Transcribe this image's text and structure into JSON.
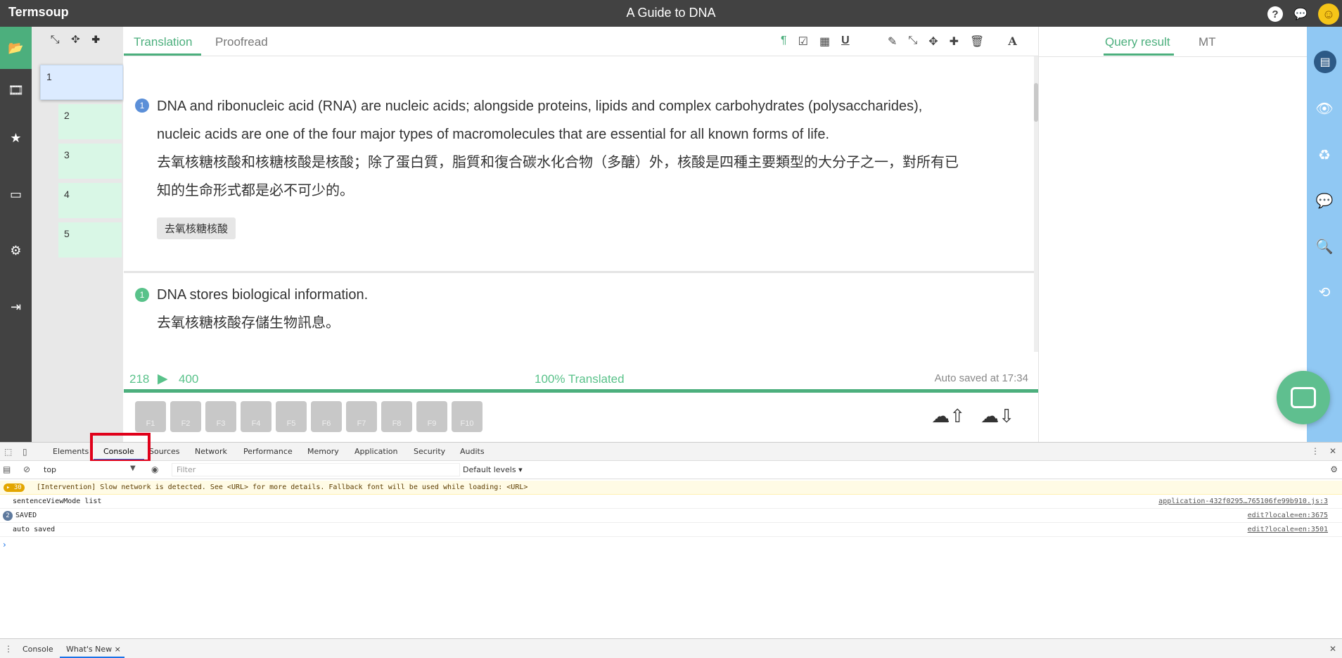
{
  "app": {
    "brand": "Termsoup",
    "title": "A Guide to DNA",
    "help_icon": "?",
    "chat_icon": "💬",
    "user_avatar": "☺"
  },
  "left_rail": {
    "icons": [
      "folder-icon",
      "film-icon",
      "star-icon",
      "store-icon",
      "gear-icon",
      "sign-out-icon"
    ],
    "glyphs": [
      "📂",
      "🎞",
      "★",
      "▭",
      "⚙",
      "⇥"
    ]
  },
  "segments": {
    "tools": "⤡ ✥ ✚",
    "items": [
      "1",
      "2",
      "3",
      "4",
      "5"
    ]
  },
  "editor": {
    "tabs": [
      "Translation",
      "Proofread"
    ],
    "toolbar_glyphs": [
      "¶",
      "☑",
      "▦",
      "U",
      "✎",
      "⤡",
      "✥",
      "✚",
      "🗑",
      "A"
    ],
    "blocks": [
      {
        "badge": "1",
        "source": "DNA and ribonucleic acid (RNA) are nucleic acids; alongside proteins, lipids and complex carbohydrates (polysaccharides), nucleic acids are one of the four major types of macromolecules that are essential for all known forms of life.",
        "target": "去氧核糖核酸和核糖核酸是核酸；除了蛋白質，脂質和復合碳水化合物（多醣）外，核酸是四種主要類型的大分子之一，對所有已知的生命形式都是必不可少的。",
        "term": "去氧核糖核酸"
      },
      {
        "badge": "1",
        "source": "DNA stores biological information.",
        "target": "去氧核糖核酸存儲生物訊息。"
      }
    ],
    "status": {
      "done": "218",
      "play_glyph": "▶",
      "total": "400",
      "translated": "100% Translated",
      "saved": "Auto saved at 17:34"
    },
    "fkeys": [
      "F1",
      "F2",
      "F3",
      "F4",
      "F5",
      "F6",
      "F7",
      "F8",
      "F9",
      "F10"
    ],
    "upload_glyph": "☁⇧",
    "download_glyph": "☁⇩"
  },
  "query_panel": {
    "tabs": [
      "Query result",
      "MT"
    ]
  },
  "right_rail": {
    "top_glyph": "▤",
    "glyphs": [
      "👁",
      "♻",
      "💬",
      "🔍",
      "⟲"
    ]
  },
  "devtools": {
    "tabs": [
      "Elements",
      "Console",
      "Sources",
      "Network",
      "Performance",
      "Memory",
      "Application",
      "Security",
      "Audits"
    ],
    "context": "top",
    "filter_placeholder": "Filter",
    "levels": "Default levels ▾",
    "logs": [
      {
        "badge": "▸ 30",
        "text": "[Intervention] Slow network is detected. See <URL> for more details. Fallback font will be used while loading: <URL>",
        "source": ""
      },
      {
        "badge": "",
        "text": "sentenceViewMode list",
        "source": "application-432f0295…765106fe99b910.js:3"
      },
      {
        "badge": "2",
        "text": "SAVED",
        "source": "edit?locale=en:3675"
      },
      {
        "badge": "",
        "text": "auto saved",
        "source": "edit?locale=en:3501"
      }
    ],
    "prompt": "›",
    "drawer_tabs": [
      "Console",
      "What's New ×"
    ]
  },
  "colors": {
    "accent": "#4caf7d",
    "topbar": "#424242",
    "right_rail": "#90c8f3",
    "highlight": "#e0001a"
  }
}
